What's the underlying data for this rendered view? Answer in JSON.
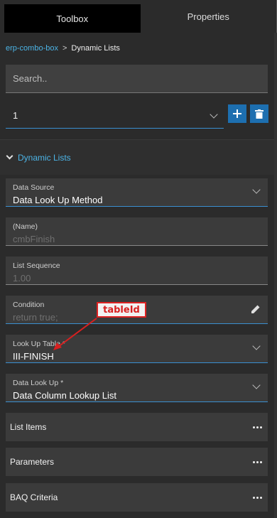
{
  "tabs": [
    {
      "label": "Toolbox"
    },
    {
      "label": "Properties"
    }
  ],
  "breadcrumb": {
    "parent": "erp-combo-box",
    "separator": ">",
    "current": "Dynamic Lists"
  },
  "search": {
    "placeholder": "Search.."
  },
  "list_selector": {
    "value": "1"
  },
  "section": {
    "title": "Dynamic Lists"
  },
  "fields": {
    "data_source": {
      "label": "Data Source",
      "value": "Data Look Up Method"
    },
    "name": {
      "label": "(Name)",
      "value": "cmbFinish"
    },
    "list_sequence": {
      "label": "List Sequence",
      "value": "1.00"
    },
    "condition": {
      "label": "Condition",
      "value": "return true;"
    },
    "look_up_table": {
      "label": "Look Up Table *",
      "value": "III-FINISH"
    },
    "data_look_up": {
      "label": "Data Look Up *",
      "value": "Data Column Lookup List"
    }
  },
  "collapsibles": [
    {
      "label": "List Items"
    },
    {
      "label": "Parameters"
    },
    {
      "label": "BAQ Criteria"
    }
  ],
  "annotation": {
    "text": "tableId"
  },
  "colors": {
    "accent": "#4cb4e6",
    "button": "#1d6fb0",
    "annotation": "#d82020"
  }
}
